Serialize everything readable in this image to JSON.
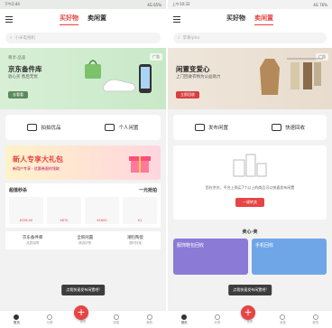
{
  "left": {
    "status": {
      "time": "下午2:44",
      "signal": "4G 65%"
    },
    "tabs": [
      "买好物",
      "卖闲置"
    ],
    "search_placeholder": "小米电视机",
    "banner": {
      "tag": "尊享·品鉴",
      "title": "京东备件库",
      "sub": "验心买 售后无忧",
      "btn": "去看看",
      "badge": "广告"
    },
    "quick": [
      "拍拍优品",
      "个人闲置"
    ],
    "promo": {
      "title": "新人专享大礼包",
      "sub": "新用户专享 · 优惠券限时领取"
    },
    "sale": {
      "title": "超值秒杀",
      "more": "一元抢拍",
      "prices": [
        "¥336.00",
        "¥870",
        "¥1600",
        "¥1"
      ]
    },
    "cats": [
      {
        "name": "京东备件库",
        "sub": "品质保障"
      },
      {
        "name": "全新闲置",
        "sub": "精选好物"
      },
      {
        "name": "潮包陶瓷",
        "sub": "限时特惠"
      }
    ],
    "toast": "点我快速发布闲置吧!",
    "nav": [
      "首页",
      "分类",
      "发布",
      "消息",
      "我的"
    ]
  },
  "right": {
    "status": {
      "time": "上午10:32",
      "signal": "4G 76%"
    },
    "tabs": [
      "买好物",
      "卖闲置"
    ],
    "search_placeholder": "苹果ipho",
    "banner": {
      "title": "闲置变爱心",
      "sub": "上门回收衣物为公益助力",
      "btn": "立即回收",
      "badge": "广告"
    },
    "quick": [
      "发布闲置",
      "快速回收"
    ],
    "empty": {
      "text": "您在京东、平台上购买7个以上的商品可以快速发布闲置",
      "btn": "一键转卖"
    },
    "mini_title": "卖心·卖",
    "minis": [
      "服饰鞋包回收",
      "手机回收"
    ],
    "toast": "点我快速发布闲置吧!",
    "nav": [
      "首页",
      "分类",
      "发布",
      "消息",
      "我的"
    ]
  }
}
